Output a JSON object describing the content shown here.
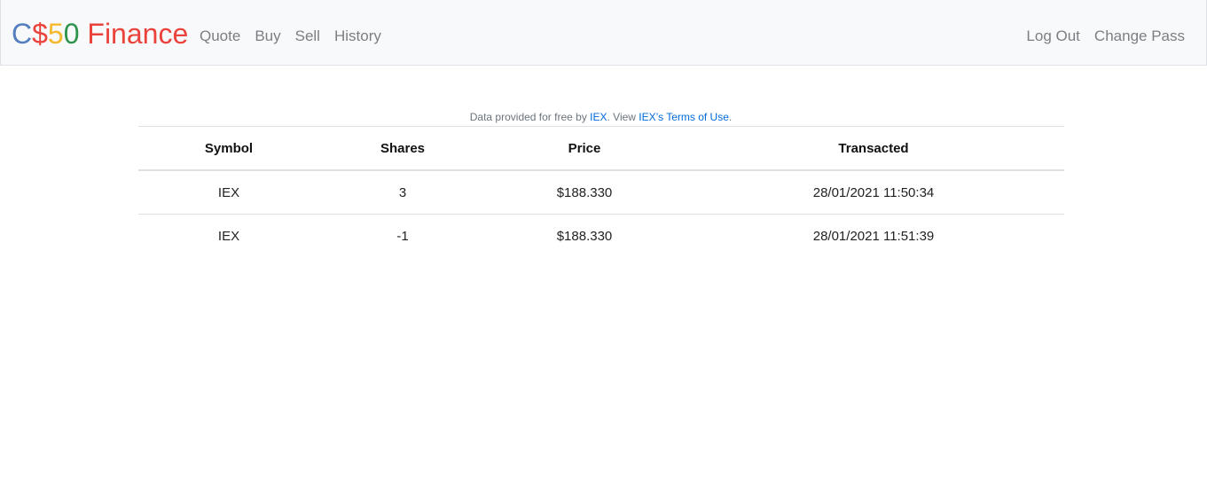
{
  "brand": {
    "parts": [
      {
        "text": "C",
        "color": "#537fbe"
      },
      {
        "text": "$",
        "color": "#ea433b"
      },
      {
        "text": "5",
        "color": "#f5b82e"
      },
      {
        "text": "0",
        "color": "#2e944b"
      },
      {
        "text": " Finance",
        "color": "#ea433b"
      }
    ]
  },
  "nav": {
    "left": [
      "Quote",
      "Buy",
      "Sell",
      "History"
    ],
    "right": [
      "Log Out",
      "Change Pass"
    ]
  },
  "attribution": {
    "prefix": "Data provided for free by ",
    "link1": "IEX",
    "middle": ". View ",
    "link2": "IEX’s Terms of Use",
    "suffix": "."
  },
  "table": {
    "headers": [
      "Symbol",
      "Shares",
      "Price",
      "Transacted"
    ],
    "rows": [
      [
        "IEX",
        "3",
        "$188.330",
        "28/01/2021 11:50:34"
      ],
      [
        "IEX",
        "-1",
        "$188.330",
        "28/01/2021 11:51:39"
      ]
    ]
  },
  "colors": {
    "navbar_bg": "#f8f9fa",
    "nav_link": "#7b7f84",
    "link": "#0069d9"
  }
}
